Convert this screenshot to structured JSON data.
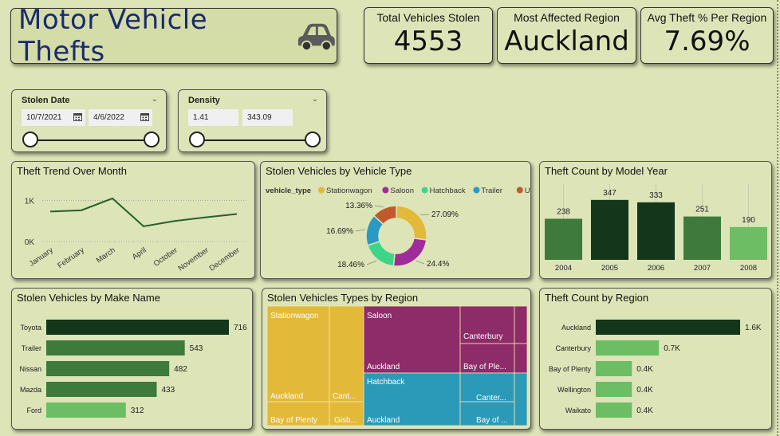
{
  "header": {
    "title": "Motor Vehicle Thefts",
    "icon": "car-icon"
  },
  "kpis": [
    {
      "label": "Total Vehicles Stolen",
      "value": "4553"
    },
    {
      "label": "Most Affected Region",
      "value": "Auckland"
    },
    {
      "label": "Avg Theft % Per Region",
      "value": "7.69%"
    }
  ],
  "slicers": {
    "date": {
      "title": "Stolen Date",
      "start": "10/7/2021",
      "end": "4/6/2022"
    },
    "density": {
      "title": "Density",
      "min": "1.41",
      "max": "343.09"
    }
  },
  "panels": {
    "trend": "Theft Trend Over Month",
    "vehicle_type": "Stolen Vehicles by Vehicle Type",
    "model_year": "Theft Count by Model Year",
    "make": "Stolen Vehicles by Make Name",
    "type_region": "Stolen Vehicles Types by Region",
    "region": "Theft Count by Region"
  },
  "colors": {
    "dark_green": "#14361a",
    "mid_green": "#3e7a3b",
    "light_green": "#6cbd63",
    "stationwagon": "#e3b93a",
    "saloon": "#a02c9b",
    "hatchback": "#3ed58a",
    "trailer": "#2a9ac4",
    "utility": "#c15a2a"
  },
  "chart_data": [
    {
      "type": "line",
      "title": "Theft Trend Over Month",
      "categories": [
        "January",
        "February",
        "March",
        "April",
        "October",
        "November",
        "December"
      ],
      "values": [
        730,
        760,
        1050,
        370,
        500,
        590,
        670
      ],
      "y_ticks": [
        "0K",
        "1K"
      ],
      "ylim": [
        0,
        1300
      ]
    },
    {
      "type": "pie",
      "title": "Stolen Vehicles by Vehicle Type",
      "legend_title": "vehicle_type",
      "labels": [
        "Stationwagon",
        "Saloon",
        "Hatchback",
        "Trailer",
        "Utility"
      ],
      "values": [
        27.09,
        24.4,
        18.46,
        16.69,
        13.36
      ],
      "value_labels": [
        "27.09%",
        "24.4%",
        "18.46%",
        "16.69%",
        "13.36%"
      ]
    },
    {
      "type": "bar",
      "title": "Theft Count by Model Year",
      "categories": [
        "2004",
        "2005",
        "2006",
        "2007",
        "2008"
      ],
      "values": [
        238,
        347,
        333,
        251,
        190
      ],
      "ylim": [
        0,
        360
      ]
    },
    {
      "type": "bar",
      "title": "Stolen Vehicles by Make Name",
      "orientation": "horizontal",
      "categories": [
        "Toyota",
        "Trailer",
        "Nissan",
        "Mazda",
        "Ford"
      ],
      "values": [
        716,
        543,
        482,
        433,
        312
      ],
      "value_labels": [
        "716",
        "543",
        "482",
        "433",
        "312"
      ]
    },
    {
      "type": "treemap",
      "title": "Stolen Vehicles Types by Region",
      "groups": [
        {
          "name": "Stationwagon",
          "value": 27.09,
          "regions": [
            "Auckland",
            "Cant...",
            "Bay of Plenty",
            "Gisb..."
          ]
        },
        {
          "name": "Saloon",
          "value": 24.4,
          "regions": [
            "Auckland",
            "Canterbury",
            "Bay of Ple..."
          ]
        },
        {
          "name": "Hatchback",
          "value": 18.46,
          "regions": [
            "Auckland",
            "Canter...",
            "Bay of ..."
          ]
        }
      ]
    },
    {
      "type": "bar",
      "title": "Theft Count by Region",
      "orientation": "horizontal",
      "categories": [
        "Auckland",
        "Canterbury",
        "Bay of Plenty",
        "Wellington",
        "Waikato"
      ],
      "values": [
        1600,
        700,
        400,
        400,
        400
      ],
      "value_labels": [
        "1.6K",
        "0.7K",
        "0.4K",
        "0.4K",
        "0.4K"
      ]
    }
  ]
}
